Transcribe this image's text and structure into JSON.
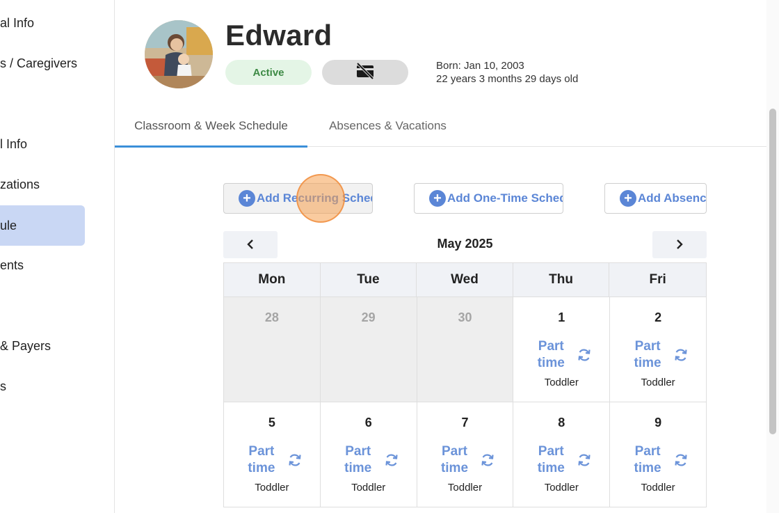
{
  "sidebar": {
    "items": [
      {
        "label": "al Info"
      },
      {
        "label": "s / Caregivers"
      },
      {
        "label": "l Info"
      },
      {
        "label": "zations"
      },
      {
        "label": "ule",
        "active": true
      },
      {
        "label": "ents"
      },
      {
        "label": "& Payers"
      },
      {
        "label": "s"
      }
    ]
  },
  "profile": {
    "name": "Edward",
    "status": "Active",
    "card_icon": "no-card-icon",
    "born": "Born: Jan 10, 2003",
    "age": "22 years 3 months 29 days old"
  },
  "tabs": [
    {
      "label": "Classroom & Week Schedule",
      "active": true
    },
    {
      "label": "Absences & Vacations"
    }
  ],
  "actions": {
    "add_recurring": "Add Recurring Schedule",
    "add_one_time": "Add One-Time Schedule",
    "add_absence": "Add Absence"
  },
  "calendar": {
    "month": "May 2025",
    "weekdays": [
      "Mon",
      "Tue",
      "Wed",
      "Thu",
      "Fri"
    ],
    "row1": {
      "d1": "28",
      "d2": "29",
      "d3": "30",
      "d4": "1",
      "d5": "2"
    },
    "row2": {
      "d1": "5",
      "d2": "6",
      "d3": "7",
      "d4": "8",
      "d5": "9"
    },
    "schedule_label": "Part time",
    "room": "Toddler"
  },
  "colors": {
    "accent": "#5b86d6",
    "active_badge_bg": "#e4f5e6",
    "active_badge_text": "#3d8a45",
    "tab_underline": "#3b8fd9"
  }
}
